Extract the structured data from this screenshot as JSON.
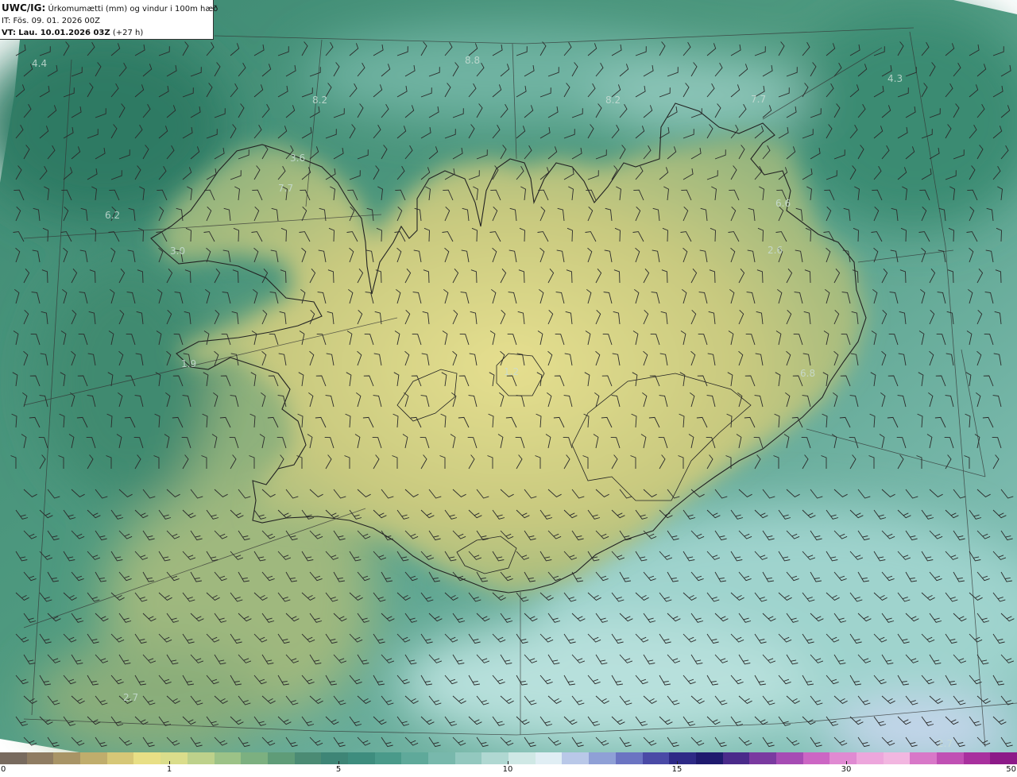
{
  "header": {
    "model": "UWC/IG:",
    "title": "Úrkomumætti (mm) og vindur i 100m hæð",
    "init_label": "IT:",
    "init_time": "Fös. 09. 01. 2026 00Z",
    "valid_label": "VT:",
    "valid_time": "Lau. 10.01.2026 03Z",
    "lead": "(+27 h)"
  },
  "colorbar": {
    "labels": [
      "0",
      "1",
      "5",
      "10",
      "15",
      "30",
      "50"
    ],
    "colors": [
      "#786a5e",
      "#8f7c62",
      "#a89466",
      "#c0ad6c",
      "#d6c777",
      "#e8df85",
      "#dadd8b",
      "#bdd18b",
      "#9cc287",
      "#7cb080",
      "#5f9c78",
      "#4b8b74",
      "#3e8576",
      "#3e8d7e",
      "#4a9a8a",
      "#5fa99a",
      "#78b8ac",
      "#93c8bf",
      "#b0d8d2",
      "#cfe8e5",
      "#e0eef4",
      "#b9c8e8",
      "#8fa0d6",
      "#6b74c2",
      "#4a4aa6",
      "#2e2a86",
      "#1f1a6e",
      "#4a2a8a",
      "#7a3aa0",
      "#a64cb4",
      "#cc66c4",
      "#e08ad2",
      "#eda6dc",
      "#f2b6e0",
      "#d878c8",
      "#c050b4",
      "#a8309e",
      "#8c1a88"
    ]
  },
  "max_labels": [
    {
      "text": "4.4"
    },
    {
      "text": "8.8"
    },
    {
      "text": "8.2"
    },
    {
      "text": "8.2"
    },
    {
      "text": "7.7"
    },
    {
      "text": "4.3"
    },
    {
      "text": "3.6"
    },
    {
      "text": "7.7"
    },
    {
      "text": "6.2"
    },
    {
      "text": "3.0"
    },
    {
      "text": "6.6"
    },
    {
      "text": "2.6"
    },
    {
      "text": "1.2"
    },
    {
      "text": "1.9"
    },
    {
      "text": "6.8"
    },
    {
      "text": "2.7"
    },
    {
      "text": "2.7"
    }
  ],
  "map": {
    "land_color": "#d8d387",
    "sea_color": "#5a9d86",
    "outline_color": "#222222",
    "barb_color": "#2a2a2a"
  }
}
